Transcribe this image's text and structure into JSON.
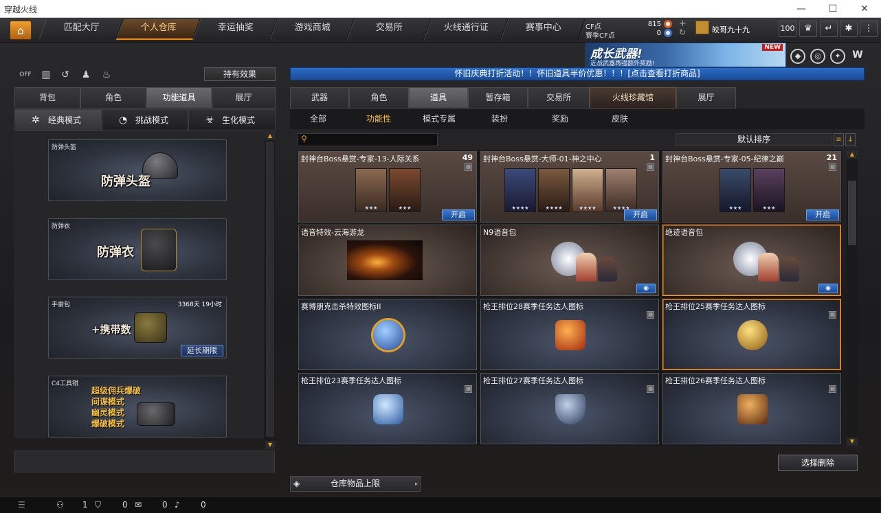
{
  "window": {
    "title": "穿越火线",
    "controls": [
      "—",
      "☐",
      "✕"
    ]
  },
  "nav": {
    "tabs": [
      "匹配大厅",
      "个人仓库",
      "幸运抽奖",
      "游戏商城",
      "交易所",
      "火线通行证",
      "赛事中心"
    ],
    "active": "个人仓库"
  },
  "currency": {
    "cf_label": "CF点",
    "cf_value": "815",
    "season_label": "赛季CF点",
    "season_value": "0"
  },
  "user": {
    "name": "皎哥九十九",
    "level": "100"
  },
  "banner": {
    "title": "成长武器!",
    "subtitle": "近战武器再强额外奖励!",
    "badge": "NEW"
  },
  "left": {
    "effect_button": "持有效果",
    "tabs": [
      "背包",
      "角色",
      "功能道具",
      "展厅"
    ],
    "active_tab": "功能道具",
    "modes": [
      "经典模式",
      "挑战模式",
      "生化模式"
    ],
    "equip": [
      {
        "label": "防弹头盔",
        "big": "防弹头盔"
      },
      {
        "label": "防弹衣",
        "big": "防弹衣"
      },
      {
        "label": "手雷包",
        "big": "+携带数",
        "time": "3368天 19小时",
        "extend": "延长期限"
      },
      {
        "label": "C4工具钳",
        "lines": [
          "超级佣兵爆破",
          "间谍模式",
          "幽灵模式",
          "爆破模式"
        ]
      }
    ]
  },
  "notice": "怀旧庆典打折活动！！怀旧道具半价优惠！！！[点击查看打折商品]",
  "right": {
    "tabs": [
      "武器",
      "角色",
      "道具",
      "暂存箱",
      "交易所",
      "火线珍藏馆",
      "展厅"
    ],
    "active_tab": "道具",
    "subtabs": [
      "全部",
      "功能性",
      "模式专属",
      "装扮",
      "奖励",
      "皮肤"
    ],
    "active_subtab": "功能性",
    "sort_label": "默认排序",
    "delete_button": "选择删除",
    "storage_button": "仓库物品上限"
  },
  "items": [
    {
      "title": "封神台Boss悬赏-专家-13-人际关系",
      "count": "49",
      "open": "开启"
    },
    {
      "title": "封神台Boss悬赏-大师-01-神之中心",
      "count": "1",
      "open": "开启"
    },
    {
      "title": "封神台Boss悬赏-专家-05-纪律之巅",
      "count": "21",
      "open": "开启"
    },
    {
      "title": "语音特效-云海游龙"
    },
    {
      "title": "N9语音包"
    },
    {
      "title": "绝迹语音包"
    },
    {
      "title": "赛博朋克击杀特效图标II"
    },
    {
      "title": "枪王排位28赛季任务达人图标"
    },
    {
      "title": "枪王排位25赛季任务达人图标"
    },
    {
      "title": "枪王排位23赛季任务达人图标"
    },
    {
      "title": "枪王排位27赛季任务达人图标"
    },
    {
      "title": "枪王排位26赛季任务达人图标"
    }
  ],
  "status": {
    "players": "1",
    "shield": "0",
    "chat": "0",
    "sound": "0"
  },
  "colors": {
    "accent": "#ff9a30",
    "notice": "#1a4c96",
    "open_button": "#2a62b8"
  }
}
